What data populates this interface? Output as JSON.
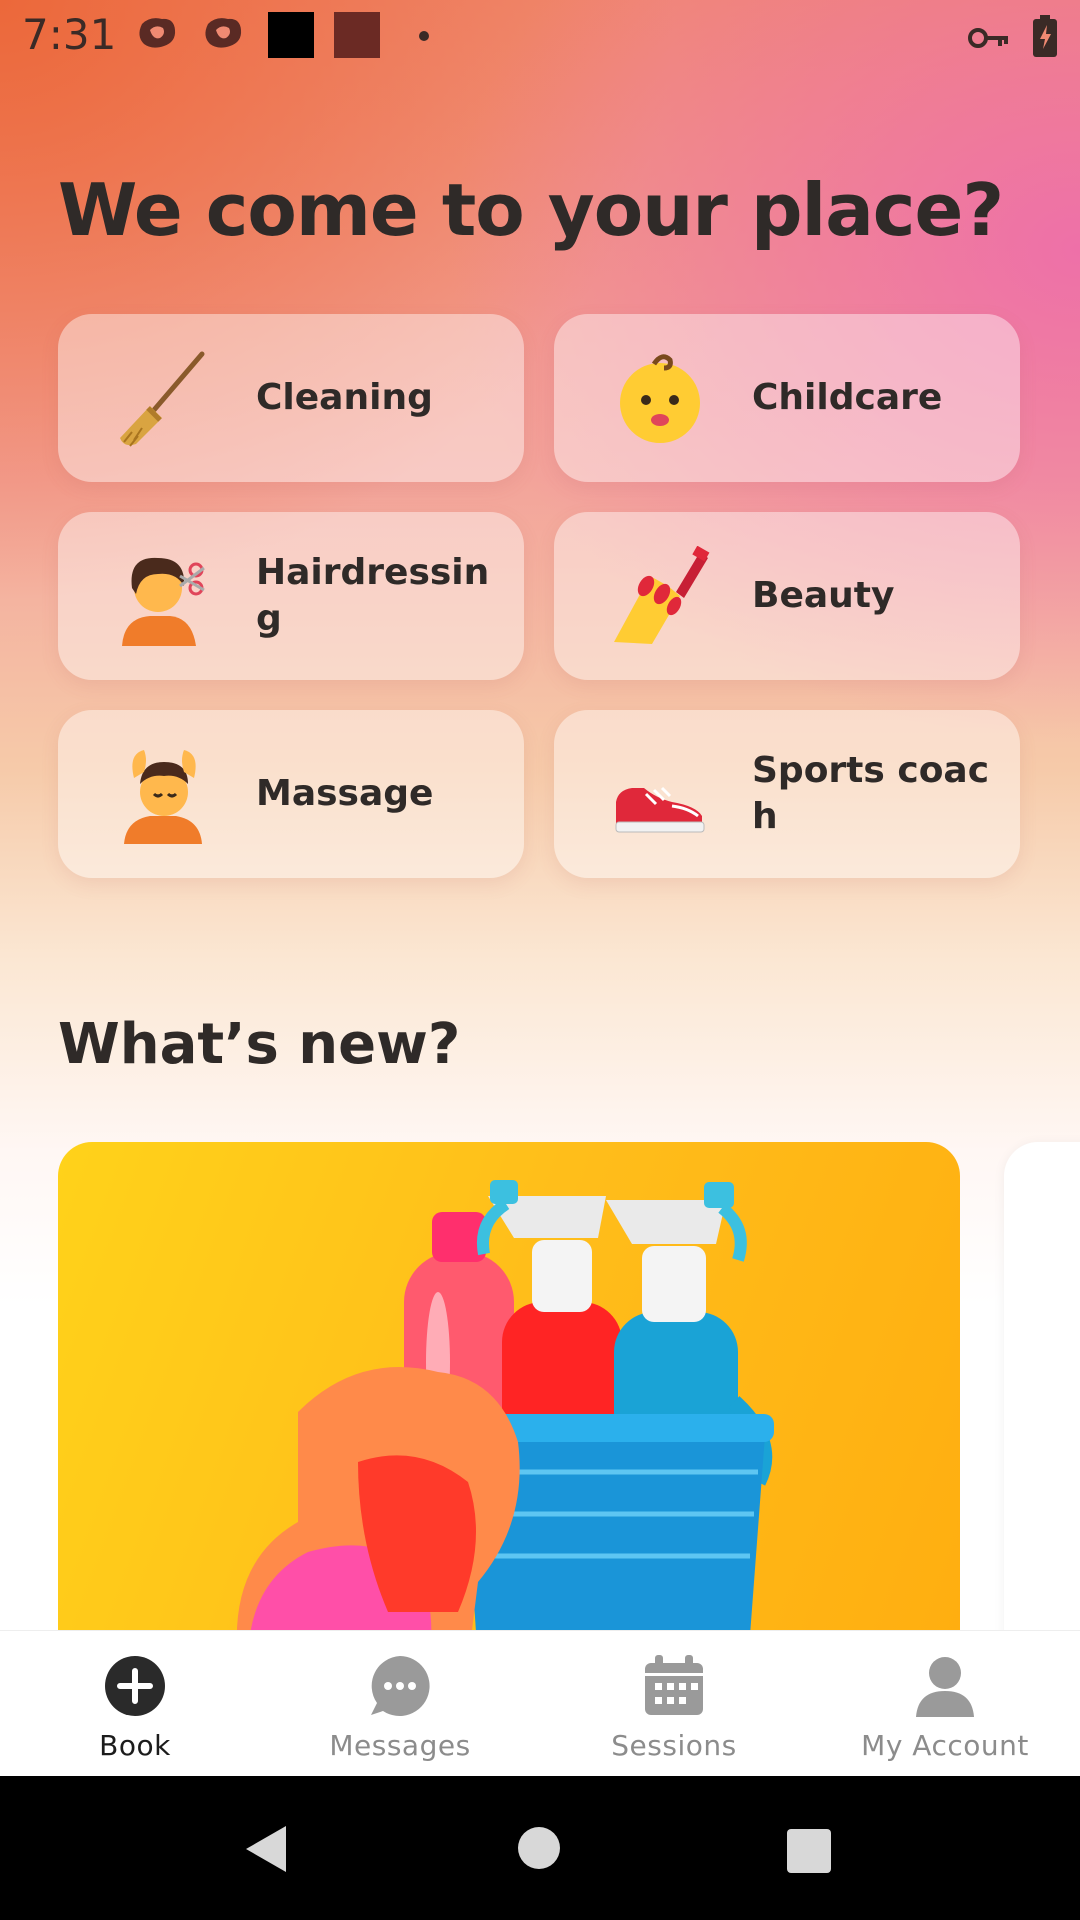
{
  "status_bar": {
    "time": "7:31",
    "icons": [
      "notification-blob-icon",
      "notification-blob-icon",
      "black-square-icon",
      "brown-square-icon",
      "dot-icon",
      "vpn-key-icon",
      "battery-charging-icon"
    ]
  },
  "headline": "We come to your place?",
  "services": [
    {
      "label": "Cleaning",
      "icon": "broom-icon"
    },
    {
      "label": "Childcare",
      "icon": "baby-icon"
    },
    {
      "label": "Hairdressing",
      "icon": "haircut-icon"
    },
    {
      "label": "Beauty",
      "icon": "nail-polish-icon"
    },
    {
      "label": "Massage",
      "icon": "massage-icon"
    },
    {
      "label": "Sports coach",
      "icon": "sneaker-icon"
    }
  ],
  "whats_new": {
    "title": "What’s new?"
  },
  "bottom_nav": {
    "items": [
      {
        "label": "Book",
        "icon": "plus-circle-icon",
        "active": true
      },
      {
        "label": "Messages",
        "icon": "chat-bubble-icon",
        "active": false
      },
      {
        "label": "Sessions",
        "icon": "calendar-icon",
        "active": false
      },
      {
        "label": "My Account",
        "icon": "person-icon",
        "active": false
      }
    ]
  },
  "colors": {
    "text": "#2f2a28",
    "nav_active": "#1c1c1c",
    "nav_inactive": "#8c8c8c",
    "news_bg": "#ffc11a"
  }
}
